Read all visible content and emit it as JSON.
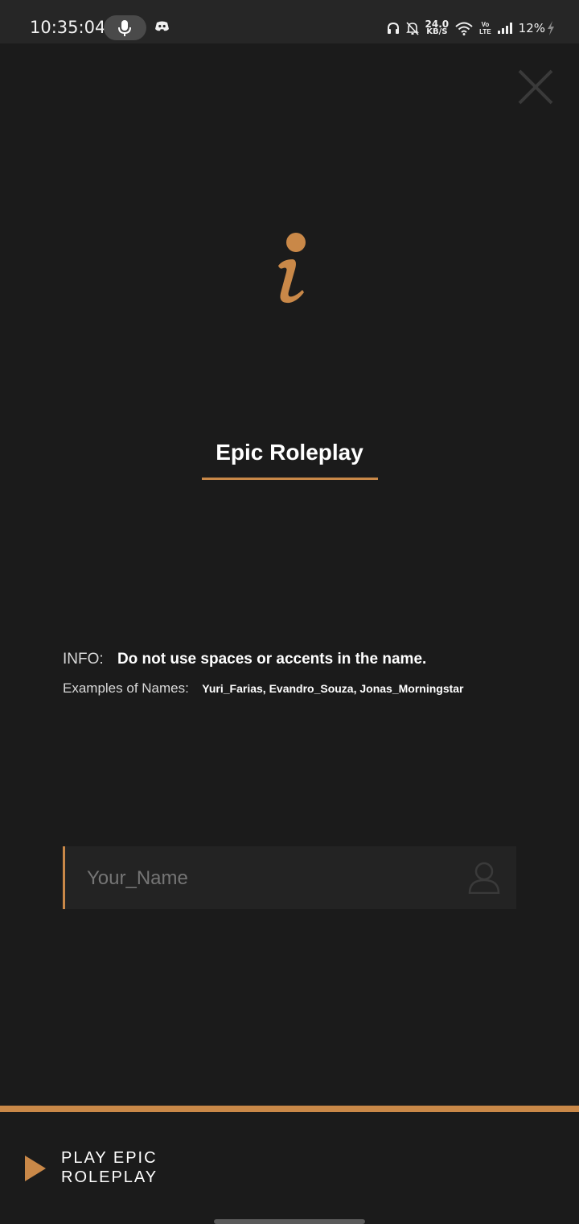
{
  "status_bar": {
    "time": "10:35:04",
    "net_speed_value": "24.0",
    "net_speed_unit": "KB/S",
    "volte_top": "Vo",
    "volte_bottom": "LTE",
    "battery": "12%"
  },
  "dialog": {
    "title": "Epic Roleplay",
    "info_label": "INFO:",
    "info_text": "Do not use spaces or accents in the name.",
    "examples_label": "Examples of Names:",
    "examples_text": "Yuri_Farias, Evandro_Souza, Jonas_Morningstar",
    "name_placeholder": "Your_Name",
    "name_value": "",
    "play_label": "PLAY EPIC ROLEPLAY"
  },
  "colors": {
    "accent": "#c98848",
    "background": "#1b1b1b",
    "field_background": "#232323",
    "status_bar": "#262626"
  },
  "icons": [
    "microphone-icon",
    "discord-icon",
    "headphones-icon",
    "bell-off-icon",
    "wifi-icon",
    "signal-icon",
    "charging-icon",
    "close-icon",
    "info-icon",
    "user-icon",
    "play-icon"
  ]
}
